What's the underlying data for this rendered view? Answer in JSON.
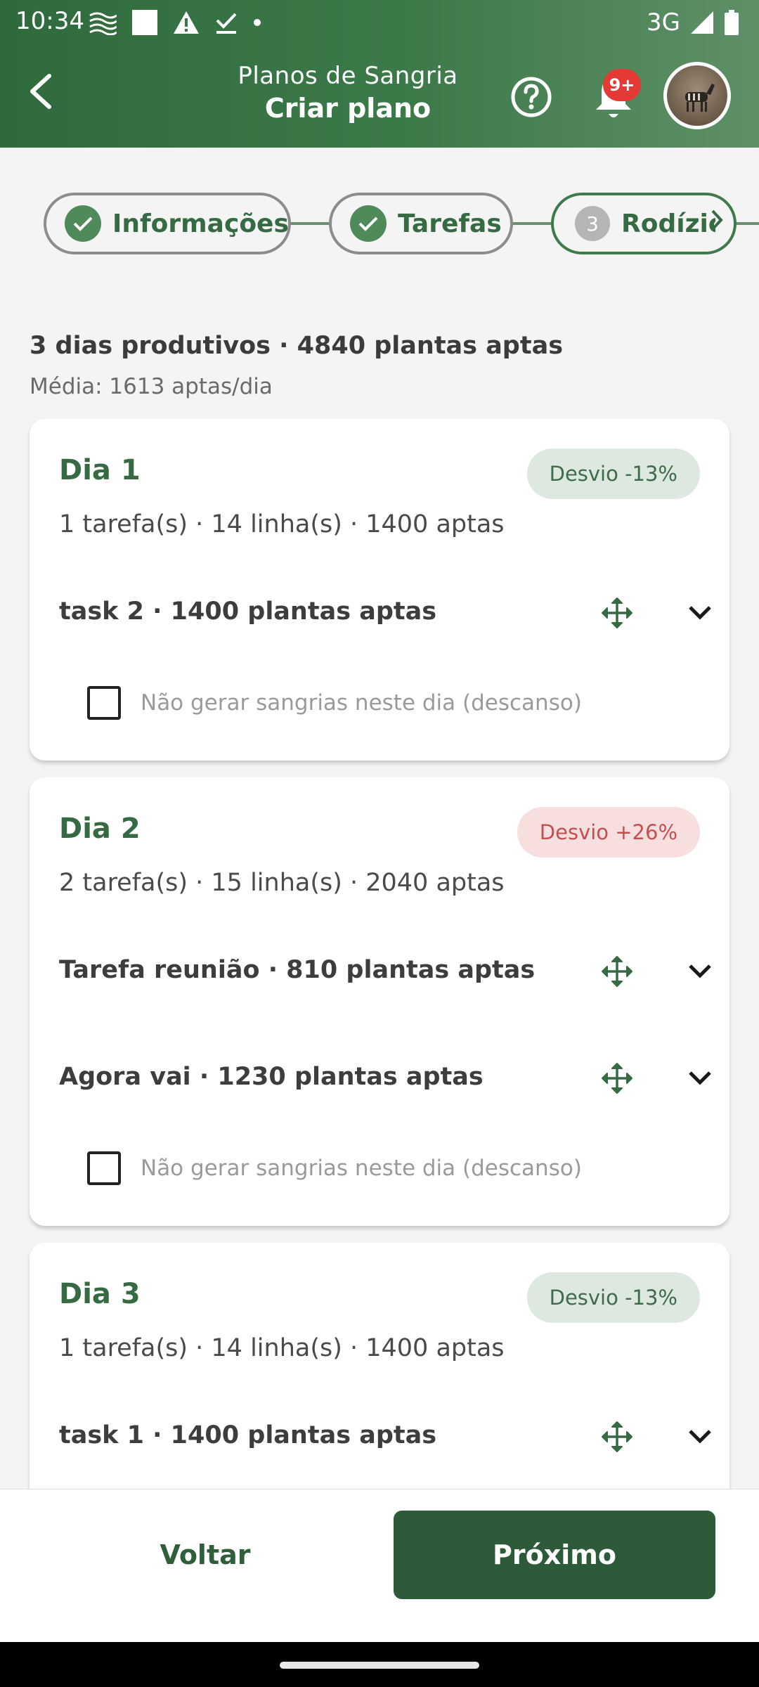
{
  "status_bar": {
    "time": "10:34",
    "network": "3G"
  },
  "header": {
    "back_icon": "arrow-back-icon",
    "subtitle": "Planos de Sangria",
    "title": "Criar plano",
    "help_icon": "help-circle-icon",
    "notifications_badge": "9+"
  },
  "stepper": {
    "steps": [
      {
        "label": "Informações",
        "state": "done"
      },
      {
        "label": "Tarefas",
        "state": "done"
      },
      {
        "number": "3",
        "label": "Rodízio",
        "state": "active"
      }
    ]
  },
  "summary": {
    "line": "3 dias produtivos · 4840 plantas aptas",
    "average": "Média: 1613 aptas/dia"
  },
  "days": [
    {
      "title": "Dia 1",
      "desvio": "Desvio -13%",
      "meta": "1 tarefa(s) · 14 linha(s) · 1400 aptas",
      "tasks": [
        "task 2 · 1400 plantas aptas"
      ],
      "rest_label": "Não gerar sangrias neste dia (descanso)"
    },
    {
      "title": "Dia 2",
      "desvio": "Desvio +26%",
      "meta": "2 tarefa(s) · 15 linha(s) · 2040 aptas",
      "tasks": [
        "Tarefa reunião · 810 plantas aptas",
        "Agora vai · 1230 plantas aptas"
      ],
      "rest_label": "Não gerar sangrias neste dia (descanso)"
    },
    {
      "title": "Dia 3",
      "desvio": "Desvio -13%",
      "meta": "1 tarefa(s) · 14 linha(s) · 1400 aptas",
      "tasks": [
        "task 1 · 1400 plantas aptas"
      ]
    }
  ],
  "footer": {
    "back_label": "Voltar",
    "next_label": "Próximo"
  },
  "colors": {
    "primary": "#2d5a38",
    "accent": "#356a42",
    "danger_badge": "#e53935"
  }
}
